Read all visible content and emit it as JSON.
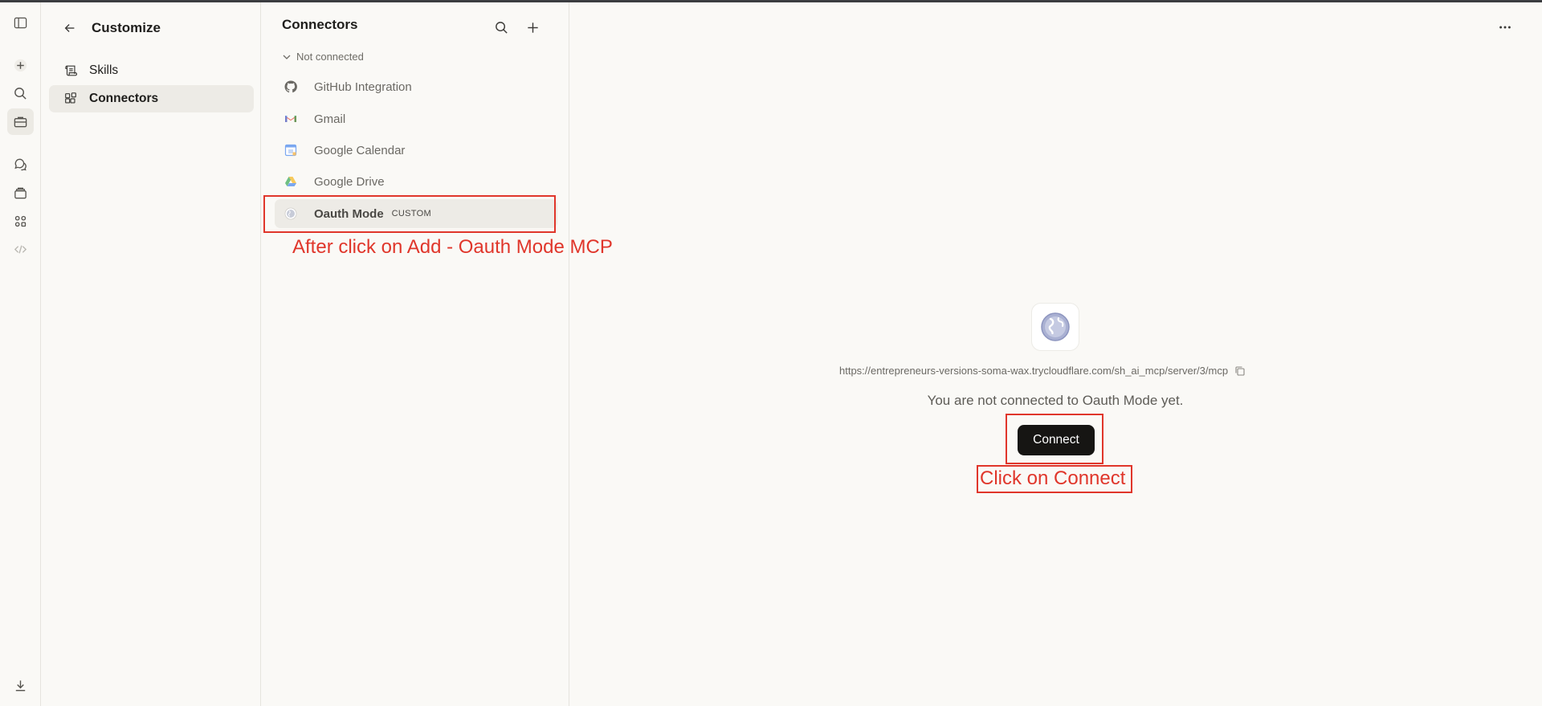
{
  "customize": {
    "title": "Customize",
    "nav": [
      {
        "label": "Skills",
        "icon": "scroll-icon"
      },
      {
        "label": "Connectors",
        "icon": "connectors-grid-icon",
        "active": true
      }
    ]
  },
  "connectors": {
    "title": "Connectors",
    "section_label": "Not connected",
    "items": [
      {
        "label": "GitHub Integration",
        "icon": "github-icon"
      },
      {
        "label": "Gmail",
        "icon": "gmail-icon"
      },
      {
        "label": "Google Calendar",
        "icon": "google-calendar-icon"
      },
      {
        "label": "Google Drive",
        "icon": "google-drive-icon"
      },
      {
        "label": "Oauth Mode",
        "badge": "CUSTOM",
        "icon": "globe-icon",
        "active": true
      }
    ]
  },
  "detail": {
    "server_url": "https://entrepreneurs-versions-soma-wax.trycloudflare.com/sh_ai_mcp/server/3/mcp",
    "status_text": "You are not connected to Oauth Mode yet.",
    "connect_label": "Connect"
  },
  "annotations": {
    "selected_note": "After click on Add - Oauth Mode MCP",
    "connect_note": "Click on Connect",
    "color": "#e0362b"
  },
  "colors": {
    "background": "#faf9f6",
    "active_item": "#edebe6",
    "primary_button": "#161513"
  }
}
